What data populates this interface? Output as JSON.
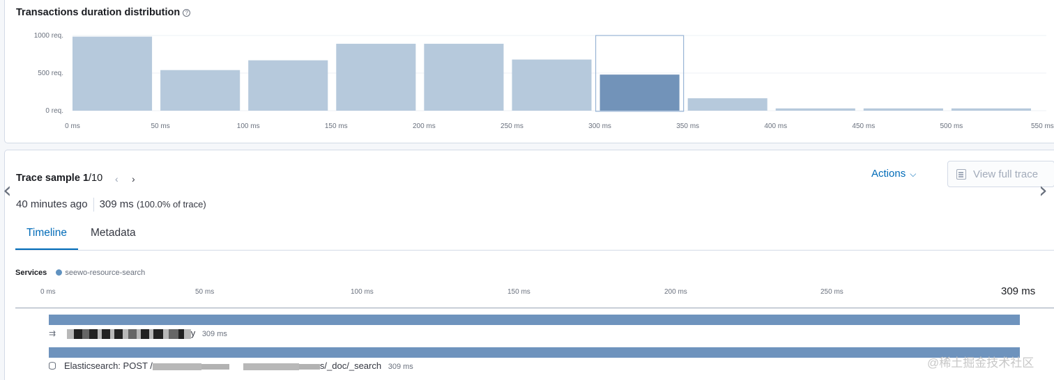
{
  "distribution": {
    "title": "Transactions duration distribution",
    "help_icon": "help-circle-icon"
  },
  "chart_data": {
    "type": "bar",
    "title": "Transactions duration distribution",
    "xlabel": "",
    "ylabel": "",
    "ylim": [
      0,
      1000
    ],
    "y_ticks": [
      "1000 req.",
      "500 req.",
      "0 req."
    ],
    "x_ticks": [
      "0 ms",
      "50 ms",
      "100 ms",
      "150 ms",
      "200 ms",
      "250 ms",
      "300 ms",
      "350 ms",
      "400 ms",
      "450 ms",
      "500 ms",
      "550 ms"
    ],
    "categories": [
      "0-50 ms",
      "50-100 ms",
      "100-150 ms",
      "150-200 ms",
      "200-250 ms",
      "250-300 ms",
      "300-350 ms",
      "350-400 ms",
      "400-450 ms",
      "450-500 ms",
      "500-550 ms"
    ],
    "values": [
      985,
      540,
      670,
      890,
      890,
      680,
      480,
      165,
      30,
      30,
      30
    ],
    "selected_index": 6,
    "colors": {
      "bar": "#b6c9dc",
      "selected": "#7293b9",
      "selected_outline": "#98b4d4"
    },
    "grid": true
  },
  "trace": {
    "label": "Trace sample",
    "index": "1",
    "total": "/10",
    "prev_icon": "chevron-left-icon",
    "next_icon": "chevron-right-icon",
    "time_ago": "40 minutes ago",
    "duration": "309 ms",
    "duration_pct": "(100.0% of trace)",
    "actions_label": "Actions",
    "view_full_trace_label": "View full trace"
  },
  "tabs": [
    {
      "label": "Timeline",
      "active": true
    },
    {
      "label": "Metadata",
      "active": false
    }
  ],
  "services": {
    "label": "Services",
    "items": [
      {
        "name": "seewo-resource-search",
        "color": "#6092c0"
      }
    ]
  },
  "timeline": {
    "ticks": [
      "0 ms",
      "50 ms",
      "100 ms",
      "150 ms",
      "200 ms",
      "250 ms"
    ],
    "total": "309 ms",
    "spans": [
      {
        "name_suffix": "y",
        "duration": "309 ms",
        "icon": "transaction-icon"
      },
      {
        "name": "Elasticsearch: POST /",
        "name_suffix": "s/_doc/_search",
        "duration": "309 ms",
        "icon": "database-icon"
      }
    ]
  },
  "watermark": "@稀土掘金技术社区"
}
